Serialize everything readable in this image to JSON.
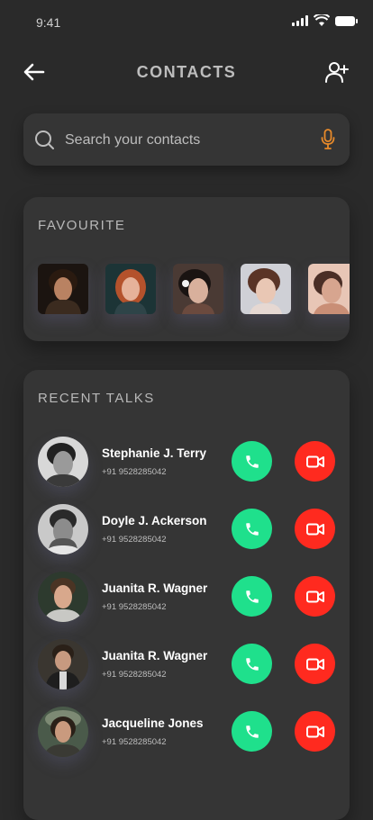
{
  "status_bar": {
    "time": "9:41"
  },
  "header": {
    "title": "CONTACTS"
  },
  "search": {
    "placeholder": "Search your contacts"
  },
  "favourites": {
    "title": "FAVOURITE",
    "items": [
      {
        "name": "favourite-1"
      },
      {
        "name": "favourite-2"
      },
      {
        "name": "favourite-3"
      },
      {
        "name": "favourite-4"
      },
      {
        "name": "favourite-5"
      }
    ]
  },
  "recent": {
    "title": "RECENT TALKS",
    "contacts": [
      {
        "name": "Stephanie J. Terry",
        "phone": "+91 9528285042"
      },
      {
        "name": "Doyle J. Ackerson",
        "phone": "+91 9528285042"
      },
      {
        "name": "Juanita R. Wagner",
        "phone": "+91 9528285042"
      },
      {
        "name": "Juanita R. Wagner",
        "phone": "+91 9528285042"
      },
      {
        "name": "Jacqueline Jones",
        "phone": "+91 9528285042"
      }
    ]
  },
  "icons": {
    "back": "arrow-left-icon",
    "add_contact": "user-plus-icon",
    "search": "search-icon",
    "mic": "mic-icon",
    "call": "phone-icon",
    "video": "video-camera-icon"
  },
  "colors": {
    "background": "#2a2a2a",
    "card": "#353535",
    "call": "#1fe08c",
    "video": "#ff2a1f",
    "mic": "#e88a2a"
  }
}
